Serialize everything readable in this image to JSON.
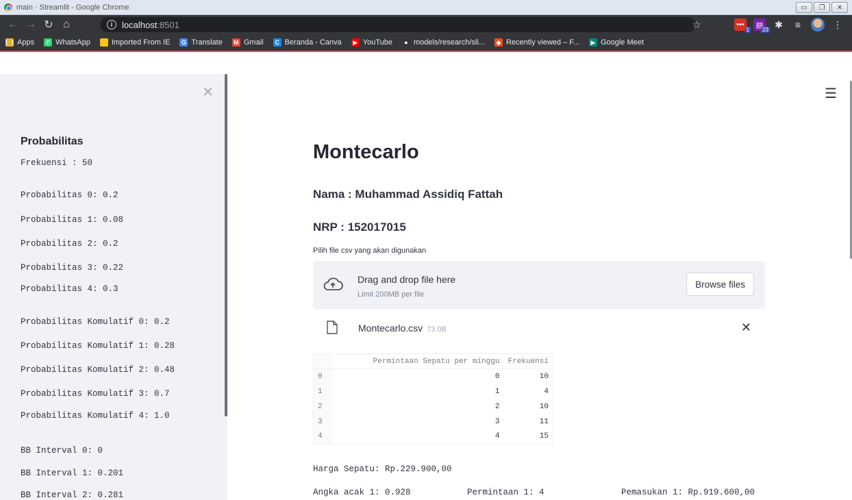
{
  "window": {
    "title": "main · Streamlit - Google Chrome"
  },
  "browser": {
    "url_host": "localhost",
    "url_port": ":8501",
    "bookmarks": [
      {
        "label": "Apps",
        "icon": "apps-grid-icon",
        "color": "#e8b030"
      },
      {
        "label": "WhatsApp",
        "icon": "whatsapp-icon",
        "color": "#25d366"
      },
      {
        "label": "Imported From IE",
        "icon": "folder-icon",
        "color": "#f5c518"
      },
      {
        "label": "Translate",
        "icon": "translate-icon",
        "color": "#4285f4"
      },
      {
        "label": "Gmail",
        "icon": "gmail-icon",
        "color": "#ea4335"
      },
      {
        "label": "Beranda - Canva",
        "icon": "canva-icon",
        "color": "#1e88e5"
      },
      {
        "label": "YouTube",
        "icon": "youtube-icon",
        "color": "#ff0000"
      },
      {
        "label": "models/research/sli...",
        "icon": "github-icon",
        "color": "#ffffff"
      },
      {
        "label": "Recently viewed – F...",
        "icon": "figma-icon",
        "color": "#f24e1e"
      },
      {
        "label": "Google Meet",
        "icon": "google-meet-icon",
        "color": "#00897b"
      }
    ],
    "ext_badges": {
      "first": "1",
      "second": "23"
    }
  },
  "sidebar": {
    "heading": "Probabilitas",
    "frekuensi": "Frekuensi : 50",
    "lines": [
      "Probabilitas 0: 0.2",
      "Probabilitas 1: 0.08",
      "Probabilitas 2: 0.2",
      "Probabilitas 3: 0.22",
      "Probabilitas 4: 0.3",
      "Probabilitas Komulatif 0: 0.2",
      "Probabilitas Komulatif 1: 0.28",
      "Probabilitas Komulatif 2: 0.48",
      "Probabilitas Komulatif 3: 0.7",
      "Probabilitas Komulatif 4: 1.0",
      "BB Interval 0: 0",
      "BB Interval 1: 0.201",
      "BB Interval 2: 0.281"
    ]
  },
  "main": {
    "title": "Montecarlo",
    "nama": "Nama : Muhammad Assidiq Fattah",
    "nrp": "NRP : 152017015",
    "uploader": {
      "label": "Pilih file csv yang akan digunakan",
      "drag_text": "Drag and drop file here",
      "limit_text": "Limit 200MB per file",
      "browse_label": "Browse files",
      "file_name": "Montecarlo.csv",
      "file_size": "73.0B"
    },
    "table": {
      "columns": [
        "",
        "Permintaan Sepatu per minggu",
        "Frekuensi"
      ],
      "rows": [
        [
          "0",
          "0",
          "10"
        ],
        [
          "1",
          "1",
          "4"
        ],
        [
          "2",
          "2",
          "10"
        ],
        [
          "3",
          "3",
          "11"
        ],
        [
          "4",
          "4",
          "15"
        ]
      ]
    },
    "harga": "Harga Sepatu: Rp.229.900,00",
    "result_row": {
      "angka": "Angka acak 1: 0.928",
      "permintaan": "Permintaan 1: 4",
      "pemasukan": "Pemasukan 1: Rp.919.600,00"
    }
  }
}
